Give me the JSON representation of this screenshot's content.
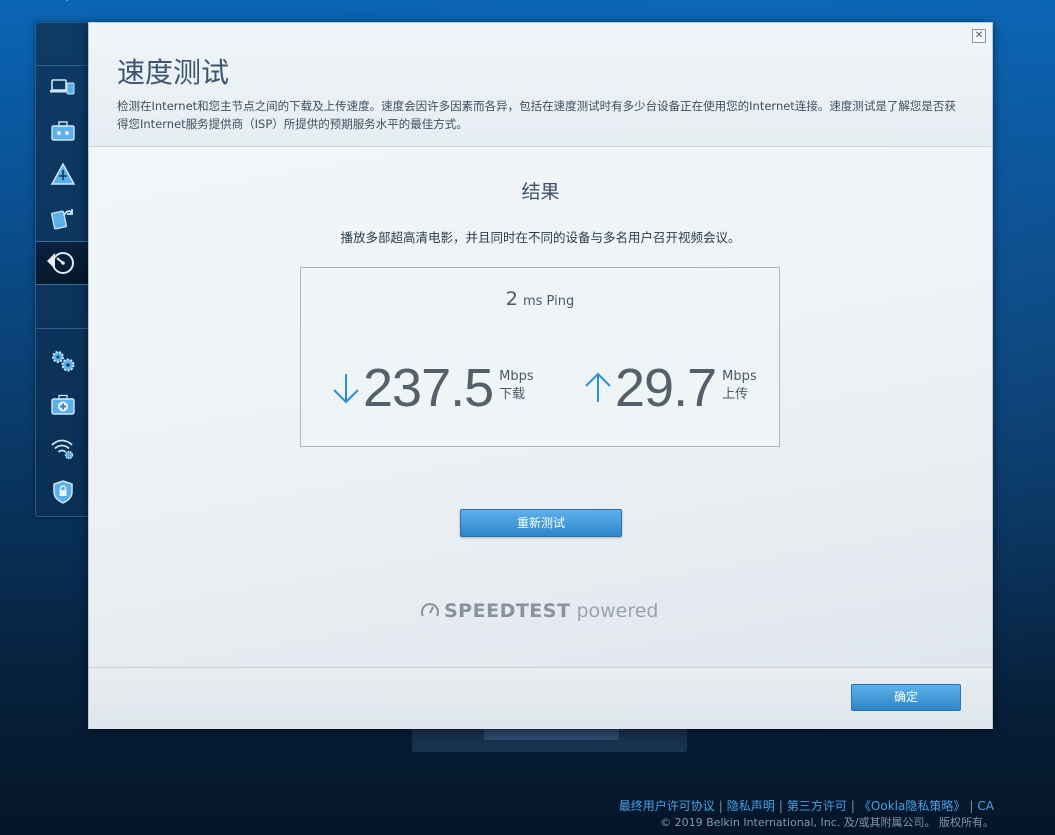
{
  "modal": {
    "title": "速度测试",
    "description": "检测在Internet和您主节点之间的下载及上传速度。速度会因许多因素而各异，包括在速度测试时有多少台设备正在使用您的Internet连接。速度测试是了解您是否获得您Internet服务提供商（ISP）所提供的预期服务水平的最佳方式。",
    "close_label": "✕"
  },
  "result": {
    "title": "结果",
    "subtitle": "播放多部超高清电影，并且同时在不同的设备与多名用户召开视频会议。",
    "ping_value": "2",
    "ping_unit": "ms Ping",
    "download_value": "237.5",
    "download_unit": "Mbps",
    "download_label": "下载",
    "upload_value": "29.7",
    "upload_unit": "Mbps",
    "upload_label": "上传"
  },
  "buttons": {
    "retest": "重新测试",
    "ok": "确定"
  },
  "branding": {
    "speedtest": "SPEEDTEST",
    "powered": "powered"
  },
  "sidebar": {
    "items": [
      {
        "icon": "devices-icon"
      },
      {
        "icon": "toolbox-icon"
      },
      {
        "icon": "network-map-icon"
      },
      {
        "icon": "update-icon"
      },
      {
        "icon": "speedometer-icon",
        "active": true
      },
      {
        "icon": "settings-gears-icon"
      },
      {
        "icon": "first-aid-icon"
      },
      {
        "icon": "wifi-settings-icon"
      },
      {
        "icon": "security-shield-icon"
      }
    ]
  },
  "footer": {
    "links": [
      "最终用户许可协议",
      "隐私声明",
      "第三方许可",
      "《Ookla隐私策略》",
      "CA"
    ],
    "copyright": "© 2019 Belkin International, Inc. 及/或其附属公司。 版权所有。"
  },
  "colors": {
    "accent": "#2f86c8",
    "arrow": "#2b8fd6",
    "title": "#3d5570"
  }
}
